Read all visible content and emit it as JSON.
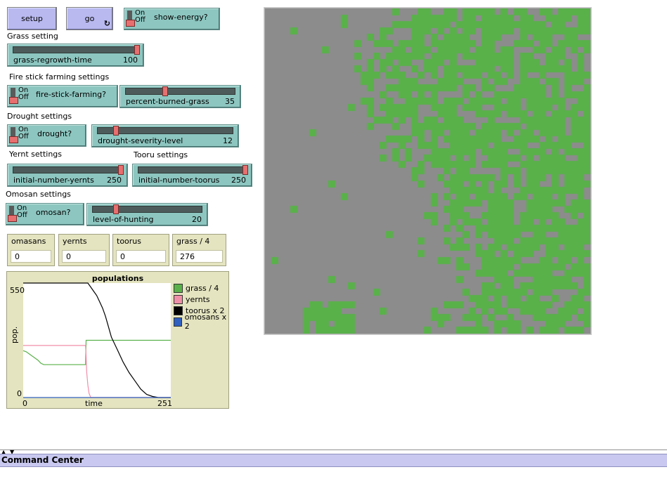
{
  "buttons": {
    "setup": "setup",
    "go": "go",
    "go_forever_glyph": "↻"
  },
  "switches": {
    "on": "On",
    "off": "Off",
    "show_energy": "show-energy?",
    "fire_stick_farming": "fire-stick-farming?",
    "drought": "drought?",
    "omosan": "omosan?"
  },
  "section_labels": {
    "grass": "Grass setting",
    "fire": "Fire stick farming settings",
    "drought": "Drought settings",
    "yernt": "Yernt settings",
    "tooru": "Tooru settings",
    "omosan": "Omosan settings"
  },
  "sliders": [
    {
      "id": "grass-regrowth-time",
      "name": "grass-regrowth-time",
      "value": "100",
      "fraction": 1.0
    },
    {
      "id": "percent-burned-grass",
      "name": "percent-burned-grass",
      "value": "35",
      "fraction": 0.35
    },
    {
      "id": "drought-severity-level",
      "name": "drought-severity-level",
      "value": "12",
      "fraction": 0.12
    },
    {
      "id": "initial-number-yernts",
      "name": "initial-number-yernts",
      "value": "250",
      "fraction": 1.0
    },
    {
      "id": "initial-number-toorus",
      "name": "initial-number-toorus",
      "value": "250",
      "fraction": 1.0
    },
    {
      "id": "level-of-hunting",
      "name": "level-of-hunting",
      "value": "20",
      "fraction": 0.2
    }
  ],
  "monitors": [
    {
      "name": "omasans",
      "value": "0"
    },
    {
      "name": "yernts",
      "value": "0"
    },
    {
      "name": "toorus",
      "value": "0"
    },
    {
      "name": "grass / 4",
      "value": "276"
    }
  ],
  "plot": {
    "title": "populations",
    "y_label": "pop.",
    "x_label": "time",
    "y_max_label": "550",
    "y_min_label": "0",
    "x_min_label": "0",
    "x_max_label": "251",
    "legend": [
      {
        "name": "grass / 4",
        "color": "#59b14a"
      },
      {
        "name": "yernts",
        "color": "#f08fa8"
      },
      {
        "name": "toorus x 2",
        "color": "#000000"
      },
      {
        "name": "omosans x 2",
        "color": "#3060c0"
      }
    ]
  },
  "chart_data": {
    "type": "line",
    "title": "populations",
    "xlabel": "time",
    "ylabel": "pop.",
    "xlim": [
      0,
      251
    ],
    "ylim": [
      0,
      550
    ],
    "series": [
      {
        "name": "grass / 4",
        "color": "#59b14a",
        "x": [
          0,
          5,
          10,
          15,
          20,
          25,
          30,
          35,
          40,
          60,
          80,
          106,
          107,
          110,
          150,
          200,
          251
        ],
        "y": [
          225,
          220,
          210,
          200,
          190,
          180,
          165,
          158,
          158,
          158,
          158,
          158,
          275,
          275,
          275,
          275,
          275
        ]
      },
      {
        "name": "yernts",
        "color": "#f08fa8",
        "x": [
          0,
          50,
          100,
          106,
          107,
          108,
          110,
          112,
          115,
          251
        ],
        "y": [
          250,
          250,
          250,
          250,
          200,
          120,
          60,
          20,
          0,
          0
        ]
      },
      {
        "name": "toorus x 2",
        "color": "#000000",
        "x": [
          0,
          50,
          100,
          110,
          115,
          120,
          125,
          130,
          135,
          140,
          145,
          150,
          160,
          170,
          180,
          190,
          200,
          210,
          220,
          230,
          251
        ],
        "y": [
          550,
          550,
          550,
          550,
          530,
          510,
          490,
          460,
          430,
          390,
          340,
          290,
          230,
          170,
          120,
          80,
          40,
          15,
          5,
          0,
          0
        ]
      },
      {
        "name": "omosans x 2",
        "color": "#3060c0",
        "x": [
          0,
          251
        ],
        "y": [
          0,
          0
        ]
      }
    ]
  },
  "world": {
    "patch_cols": 51,
    "patch_rows": 51,
    "grass_color": "#59b14a",
    "bare_color": "#8c8c8c"
  },
  "command_center": {
    "title": "Command Center"
  }
}
